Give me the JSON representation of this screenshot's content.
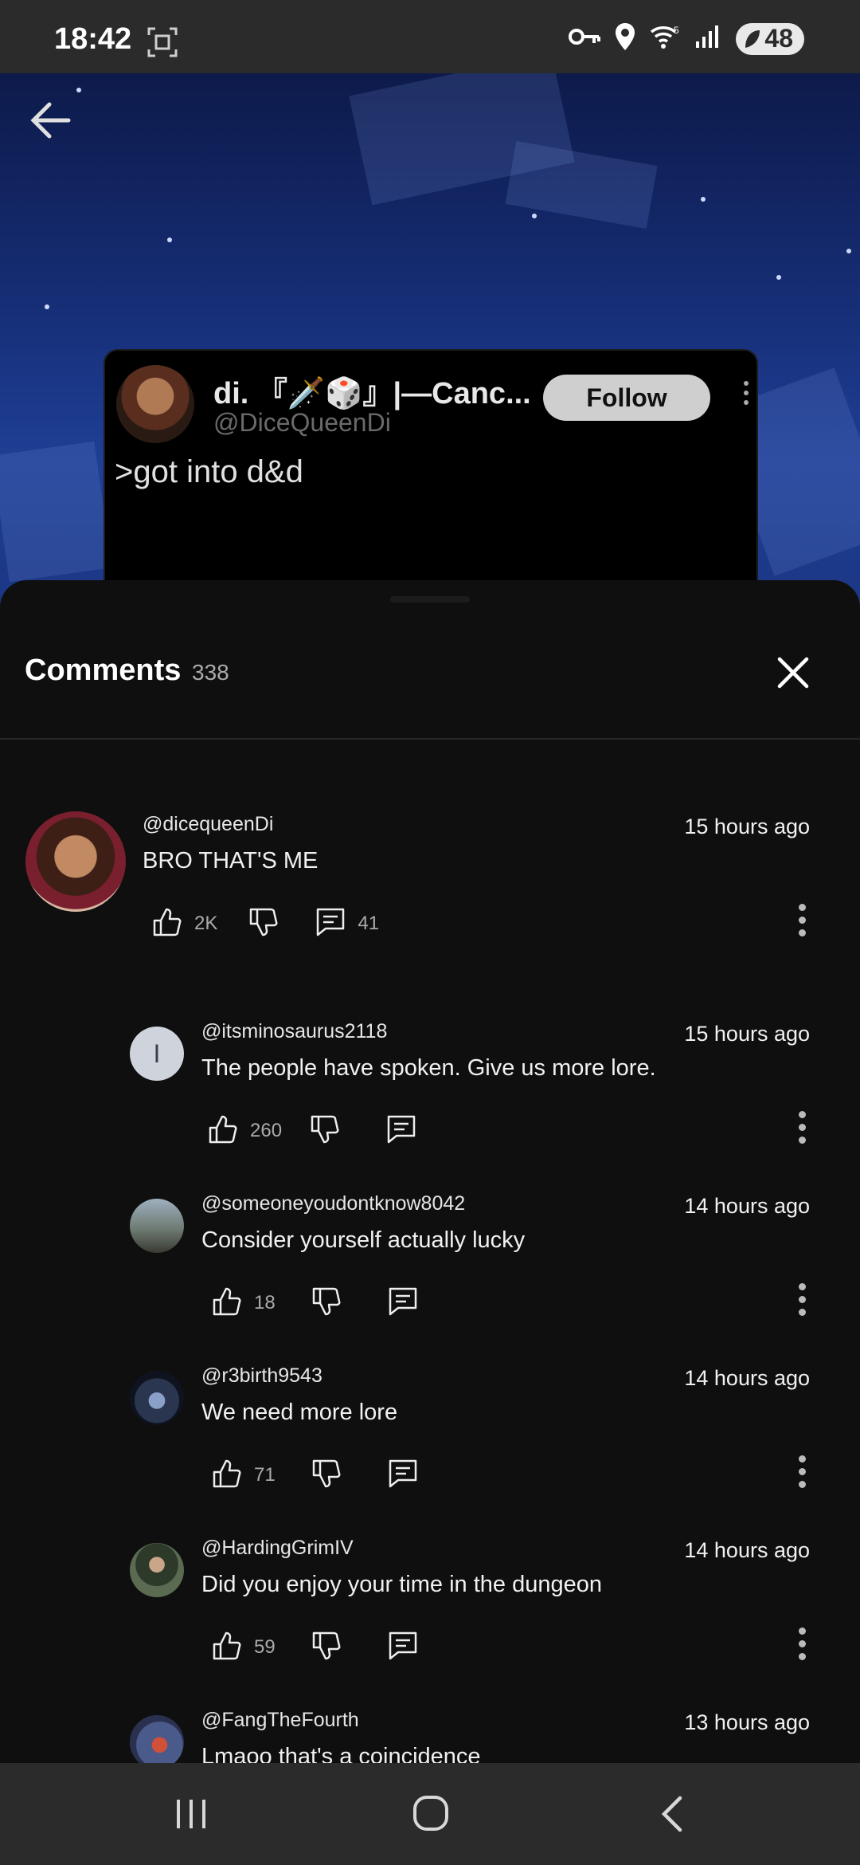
{
  "status_bar": {
    "time": "18:42",
    "battery": "48"
  },
  "video": {
    "card": {
      "display_name": "di. 『🗡️🎲』|—Canc...",
      "handle": "@DiceQueenDi",
      "follow_label": "Follow",
      "post_text": ">got into d&d"
    }
  },
  "comments_panel": {
    "title": "Comments",
    "count": "338",
    "comments": [
      {
        "user": "@dicequeenDi",
        "time": "15 hours ago",
        "text": "BRO THAT'S ME",
        "likes": "2K",
        "replies": "41"
      },
      {
        "user": "@itsminosaurus2118",
        "avatar_letter": "I",
        "time": "15 hours ago",
        "text": "The people have spoken. Give us more lore.",
        "likes": "260"
      },
      {
        "user": "@someoneyoudontknow8042",
        "time": "14 hours ago",
        "text": "Consider yourself actually lucky",
        "likes": "18"
      },
      {
        "user": "@r3birth9543",
        "time": "14 hours ago",
        "text": "We need more lore",
        "likes": "71"
      },
      {
        "user": "@HardingGrimIV",
        "time": "14 hours ago",
        "text": "Did you enjoy your time in the dungeon",
        "likes": "59"
      },
      {
        "user": "@FangTheFourth",
        "time": "13 hours ago",
        "text": "Lmaoo that's a coincidence"
      }
    ]
  },
  "colors": {
    "status_bar": "#2b2b2b",
    "sheet": "#0f0f0f",
    "video_blue": "#1f3f96",
    "follow_button": "#cfcfcf"
  }
}
